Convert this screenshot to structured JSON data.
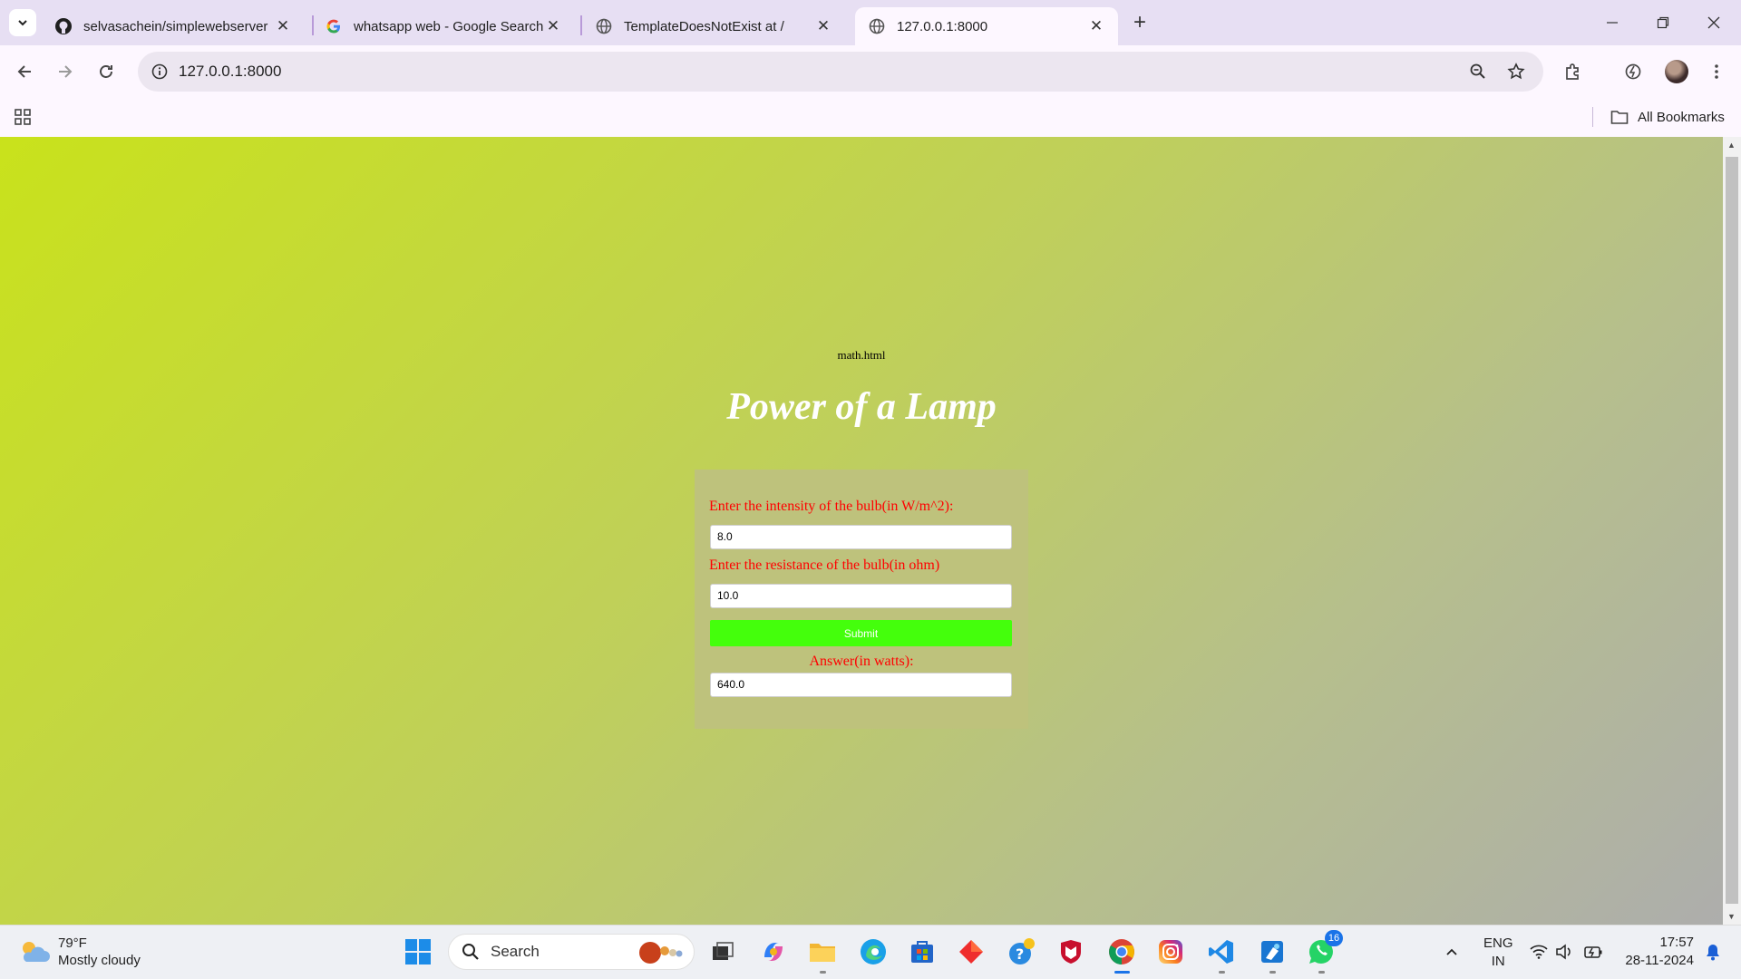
{
  "tabs": [
    {
      "title": "selvasachein/simplewebserver",
      "icon": "github-icon"
    },
    {
      "title": "whatsapp web - Google Search",
      "icon": "google-icon"
    },
    {
      "title": "TemplateDoesNotExist at /",
      "icon": "globe-icon"
    },
    {
      "title": "127.0.0.1:8000",
      "icon": "globe-icon",
      "active": true
    }
  ],
  "address_bar": {
    "url": "127.0.0.1:8000"
  },
  "bookmarks_bar": {
    "all_bookmarks_label": "All Bookmarks"
  },
  "page": {
    "file_label": "math.html",
    "heading": "Power of a Lamp",
    "intensity_label": "Enter the intensity of the bulb(in W/m^2):",
    "intensity_value": "8.0",
    "resistance_label": "Enter the resistance of the bulb(in ohm)",
    "resistance_value": "10.0",
    "submit_label": "Submit",
    "answer_label": "Answer(in watts):",
    "answer_value": "640.0",
    "colors": {
      "label_red": "#ff0000",
      "submit_green": "#44ff0c",
      "heading_white": "#ffffff"
    }
  },
  "taskbar": {
    "weather_temp": "79°F",
    "weather_desc": "Mostly cloudy",
    "search_placeholder": "Search",
    "whatsapp_badge": "16",
    "lang_line1": "ENG",
    "lang_line2": "IN",
    "time": "17:57",
    "date": "28-11-2024"
  }
}
